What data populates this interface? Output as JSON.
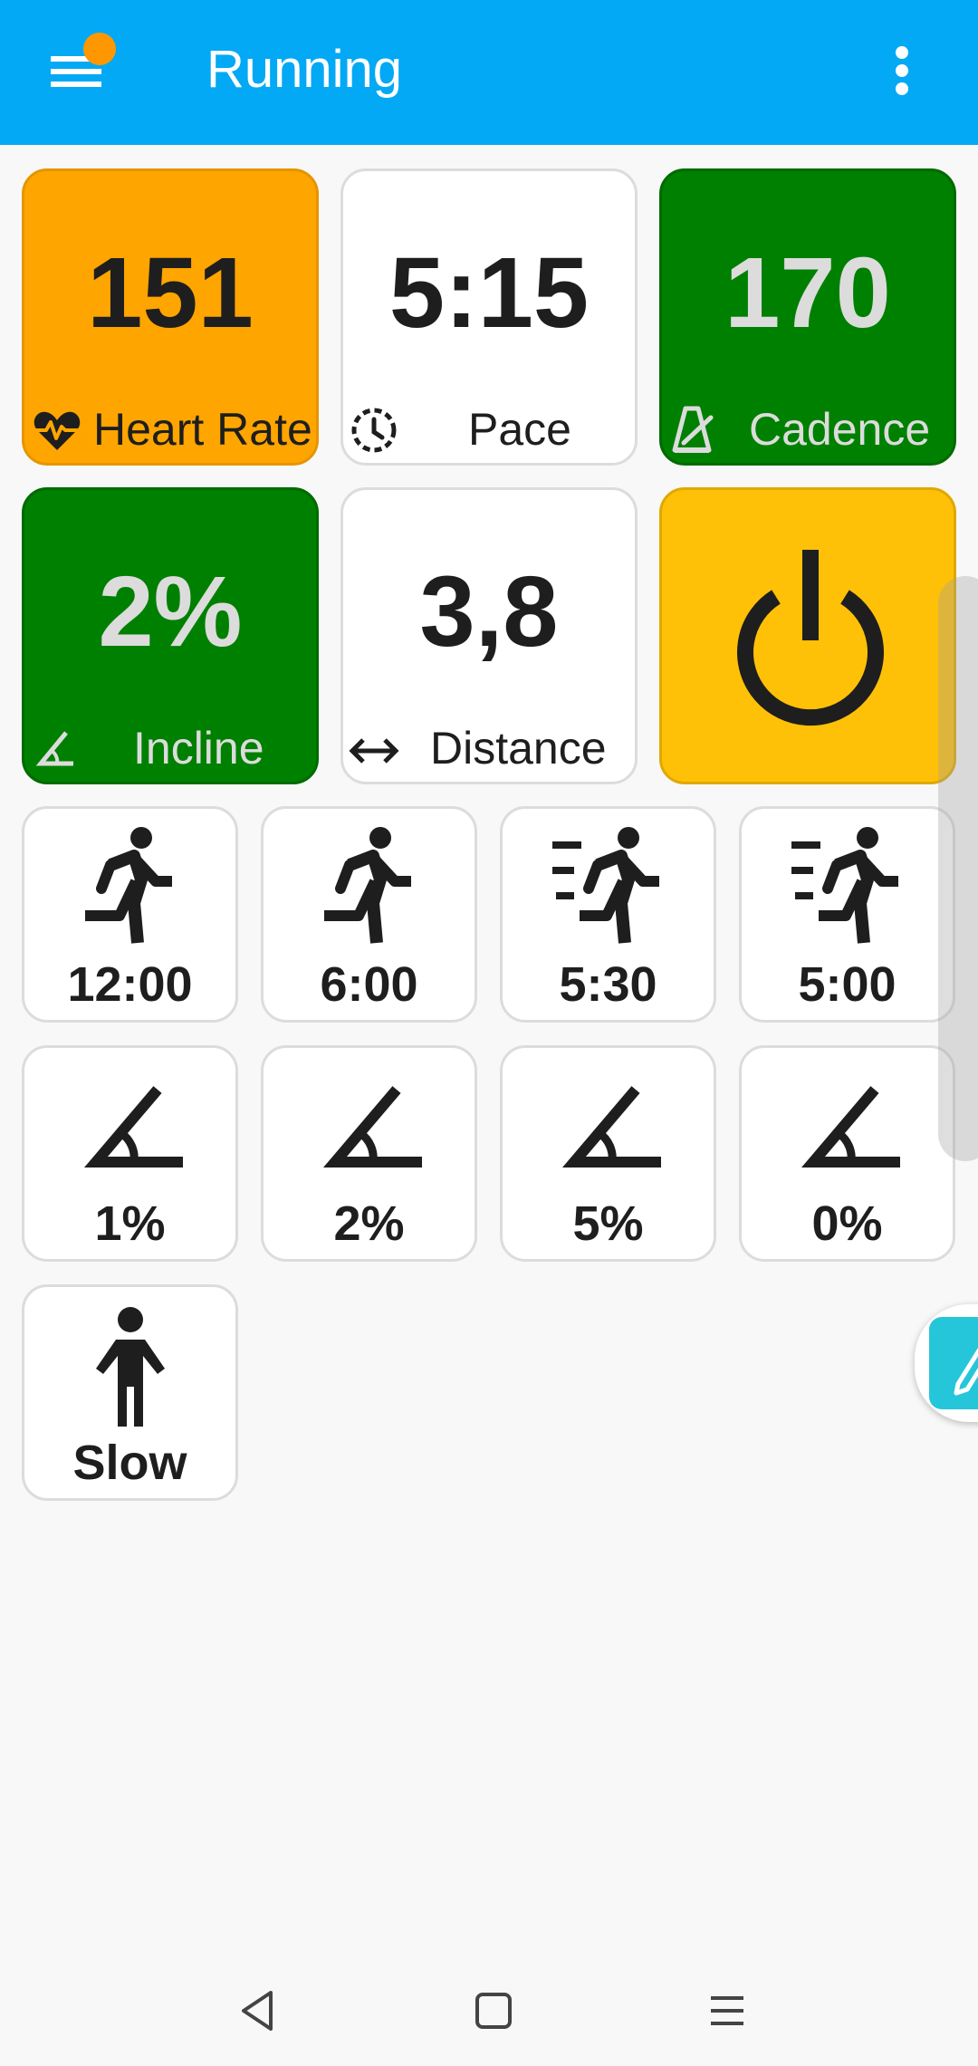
{
  "app": {
    "title": "Running"
  },
  "colors": {
    "appbar": "#03a9f4",
    "orange": "#ffa500",
    "green": "#008000",
    "gold": "#ffc107",
    "fab": "#26c6da"
  },
  "metrics": {
    "heart_rate": {
      "value": "151",
      "label": "Heart Rate",
      "icon": "heart-pulse-icon"
    },
    "pace": {
      "value": "5:15",
      "label": "Pace",
      "icon": "timer-icon"
    },
    "cadence": {
      "value": "170",
      "label": "Cadence",
      "icon": "metronome-icon"
    },
    "incline": {
      "value": "2%",
      "label": "Incline",
      "icon": "angle-icon"
    },
    "distance": {
      "value": "3,8",
      "label": "Distance",
      "icon": "double-arrow-icon"
    },
    "power": {
      "icon": "power-icon"
    }
  },
  "pace_buttons": [
    {
      "label": "12:00",
      "icon": "run-icon"
    },
    {
      "label": "6:00",
      "icon": "run-icon"
    },
    {
      "label": "5:30",
      "icon": "run-fast-icon"
    },
    {
      "label": "5:00",
      "icon": "run-fast-icon"
    }
  ],
  "incline_buttons": [
    {
      "label": "1%",
      "icon": "angle-icon"
    },
    {
      "label": "2%",
      "icon": "angle-icon"
    },
    {
      "label": "5%",
      "icon": "angle-icon"
    },
    {
      "label": "0%",
      "icon": "angle-icon"
    }
  ],
  "mode_buttons": [
    {
      "label": "Slow",
      "icon": "standing-person-icon"
    }
  ]
}
